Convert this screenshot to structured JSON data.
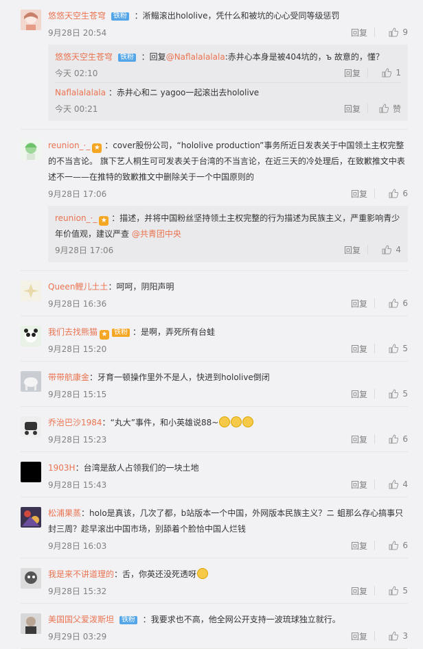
{
  "ui": {
    "reply": "回复",
    "like_word": "赞",
    "fan_badge": "铁粉"
  },
  "comments": [
    {
      "user": "悠悠天空生苍穹",
      "colon": "：",
      "text": "淅鳎滚出hololive，凭什么和被坑的心心受同等级惩罚",
      "time": "9月28日 20:54",
      "likes": "9",
      "subs": [
        {
          "user": "悠悠天空生苍穹",
          "prefix": "：回复",
          "mention": "@Naflalalalala",
          "text": ":赤井心本身是被404坑的，ъ 故意的，懂？",
          "time": "今天 02:10",
          "likes": "1"
        },
        {
          "user": "Naflalalalala",
          "prefix": "：赤井心和ニ yagoo一起滚出去hololive",
          "mention": "",
          "text": "",
          "time": "今天 00:21",
          "likes": "赞"
        }
      ]
    },
    {
      "user": "reunion_·_",
      "colon": "：",
      "text": "cover股份公司，“hololive production”事务所近日发表关于中国领土主权完整的不当言论。 旗下艺人桐生可可发表关于台湾的不当言论，在近三天的冷处理后，在致歉推文中表述不一——在推特的致歉推文中删除关于一个中国原则的",
      "time": "9月28日 17:06",
      "likes": "6",
      "subs": [
        {
          "user": "reunion_·_",
          "prefix": "：描述，并将中国粉丝坚持领土主权完整的行为描述为民族主义，严重影响青少年价值观，建议严查 ",
          "mention": "@共青团中央",
          "text": "",
          "time": "9月28日 17:06",
          "likes": "4"
        }
      ]
    },
    {
      "user": "Queen鲤儿土土",
      "colon": "：",
      "text": "呵呵，阴阳声明",
      "time": "9月28日 16:36",
      "likes": "6"
    },
    {
      "user": "我们去找熊猫",
      "colon": "：",
      "text": "是啊，弄死所有台蛙",
      "time": "9月28日 15:20",
      "likes": "5"
    },
    {
      "user": "带带航康金",
      "colon": "：",
      "text": "牙育一顿操作里外不是人，快进到hololive倒闭",
      "time": "9月28日 15:15",
      "likes": "5"
    },
    {
      "user": "乔治巴沙1984",
      "colon": "：",
      "text": "“丸大”事件，和小英雄说88~",
      "time": "9月28日 15:23",
      "likes": "6"
    },
    {
      "user": "1903H",
      "colon": "：",
      "text": "台湾是敌人占领我们的一块土地",
      "time": "9月28日 15:43",
      "likes": "4"
    },
    {
      "user": "松浦果蒸",
      "colon": "：",
      "text": "holo是真该，几次了都，b站版本一个中国，外网版本民族主义？ニ 蛆那么存心搞事只封三周？趁早滚出中国市场，别舔着个脸恰中国人烂钱",
      "time": "9月28日 16:03",
      "likes": "6"
    },
    {
      "user": "我是来不讲道理的",
      "colon": "：",
      "text": "舌，你英还没死透呀",
      "time": "9月28日 15:32",
      "likes": "5"
    },
    {
      "user": "美国国父爱泼斯坦",
      "colon": "：",
      "text": "我要求也不高，他全网公开支持一波琉球独立就行。",
      "time": "9月29日 03:29",
      "likes": "3"
    }
  ],
  "colors": {
    "username": "#eb7350",
    "badge": "#55a6e8",
    "background": "#f2f2f5"
  }
}
